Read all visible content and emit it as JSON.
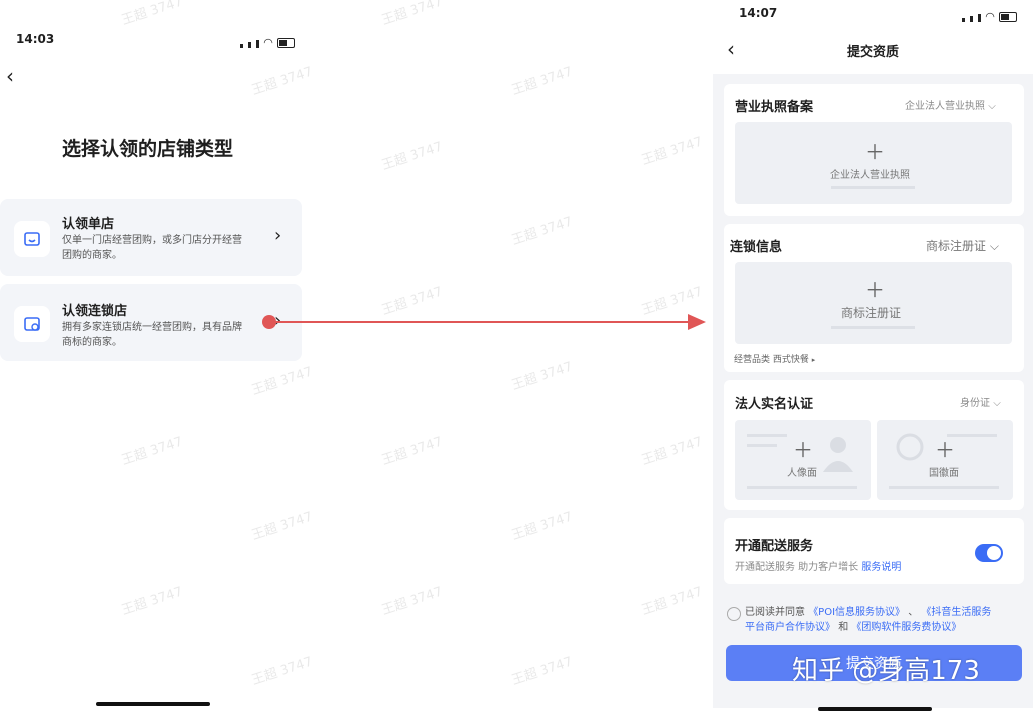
{
  "watermark": "王超 3747",
  "left_screen": {
    "status_time": "14:03",
    "page_title": "选择认领的店铺类型",
    "options": [
      {
        "title": "认领单店",
        "desc_line1": "仅单一门店经营团购，或多门店分开经营",
        "desc_line2": "团购的商家。"
      },
      {
        "title": "认领连锁店",
        "desc_line1": "拥有多家连锁店统一经营团购，具有品牌",
        "desc_line2": "商标的商家。"
      }
    ]
  },
  "arrow_color": "#e05656",
  "right_screen": {
    "status_time": "14:07",
    "nav_title": "提交资质",
    "business_license": {
      "title": "营业执照备案",
      "select": "企业法人营业执照",
      "upload_label": "企业法人营业执照"
    },
    "chain_info": {
      "title": "连锁信息",
      "select": "商标注册证",
      "upload_label": "商标注册证",
      "category_label": "经营品类",
      "category_value": "西式快餐"
    },
    "real_name": {
      "title": "法人实名认证",
      "select": "身份证",
      "front_label": "人像面",
      "back_label": "国徽面"
    },
    "delivery": {
      "title": "开通配送服务",
      "desc": "开通配送服务 助力客户增长",
      "link": "服务说明"
    },
    "agreement": {
      "prefix": "已阅读并同意",
      "doc1": "《POI信息服务协议》",
      "sep": "、",
      "doc2_line1": "《抖音生活服务",
      "doc2_line2": "平台商户合作协议》",
      "and": "和",
      "doc3": "《团购软件服务费协议》"
    },
    "submit_label": "提交资质"
  },
  "overlay_watermark": "知乎 @身高173",
  "accent_color": "#3a6cf5"
}
